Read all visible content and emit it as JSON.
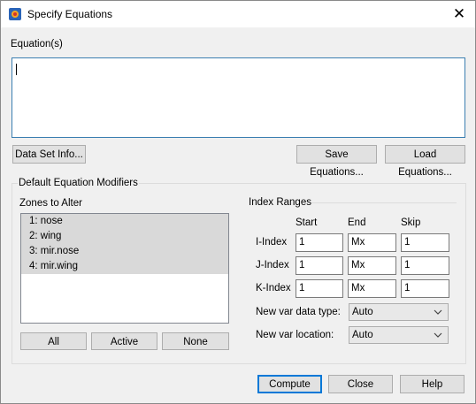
{
  "window": {
    "title": "Specify Equations"
  },
  "equations": {
    "label": "Equation(s)",
    "value": ""
  },
  "buttons": {
    "data_set_info": "Data Set Info...",
    "save_equations": "Save Equations...",
    "load_equations": "Load Equations..."
  },
  "modifiers": {
    "title": "Default Equation Modifiers",
    "zones_label": "Zones to Alter",
    "zones": [
      "1: nose",
      "2: wing",
      "3: mir.nose",
      "4: mir.wing"
    ],
    "zone_buttons": {
      "all": "All",
      "active": "Active",
      "none": "None"
    },
    "index_ranges": {
      "title": "Index Ranges",
      "col_start": "Start",
      "col_end": "End",
      "col_skip": "Skip",
      "rows": [
        {
          "label": "I-Index",
          "start": "1",
          "end": "Mx",
          "skip": "1"
        },
        {
          "label": "J-Index",
          "start": "1",
          "end": "Mx",
          "skip": "1"
        },
        {
          "label": "K-Index",
          "start": "1",
          "end": "Mx",
          "skip": "1"
        }
      ]
    },
    "new_var_data_type": {
      "label": "New var data type:",
      "value": "Auto"
    },
    "new_var_location": {
      "label": "New var location:",
      "value": "Auto"
    }
  },
  "footer": {
    "compute": "Compute",
    "close": "Close",
    "help": "Help"
  }
}
